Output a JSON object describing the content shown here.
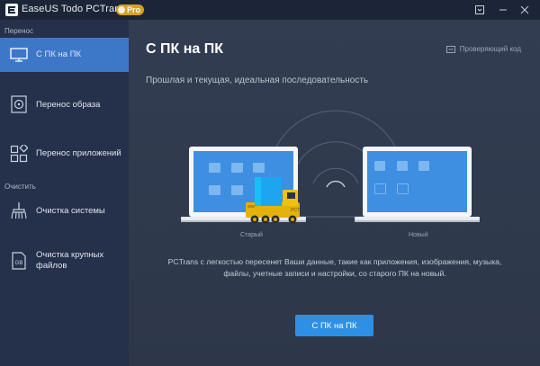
{
  "app": {
    "title": "EaseUS Todo PCTrans",
    "badge": "Pro"
  },
  "sidebar": {
    "sections": [
      {
        "label": "Перенос"
      },
      {
        "label": "Очистить"
      }
    ],
    "items": [
      {
        "label": "С ПК на ПК",
        "icon": "monitor-icon",
        "active": true
      },
      {
        "label": "Перенос образа",
        "icon": "disc-image-icon"
      },
      {
        "label": "Перенос приложений",
        "icon": "apps-icon"
      },
      {
        "label": "Очистка системы",
        "icon": "broom-icon"
      },
      {
        "label": "Очистка крупных файлов",
        "line1": "Очистка крупных",
        "line2": "файлов",
        "icon": "gb-file-icon"
      }
    ]
  },
  "main": {
    "title": "С ПК на ПК",
    "verify_link": "Проверяющий код",
    "subtitle": "Прошлая и текущая, идеальная последовательность",
    "old_label": "Старый",
    "new_label": "Новый",
    "description_line1": "PCTrans с легкостью пересенет Ваши данные, такие как приложения, изображения, музыка,",
    "description_line2": "файлы, учетные записи и настройки, со старого ПК на новый.",
    "cta_label": "С ПК на ПК"
  },
  "colors": {
    "accent": "#2e8fe6",
    "active_nav": "#3d78c8",
    "badge": "#d6a11e"
  }
}
